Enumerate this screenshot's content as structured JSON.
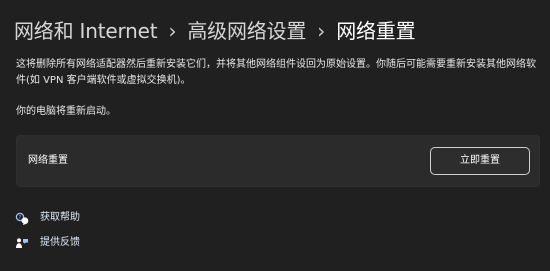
{
  "breadcrumb": {
    "items": [
      "网络和 Internet",
      "高级网络设置",
      "网络重置"
    ],
    "separator": "›"
  },
  "description": "这将删除所有网络适配器然后重新安装它们，并将其他网络组件设回为原始设置。你随后可能需要重新安装其他网络软件(如 VPN 客户端软件或虚拟交换机)。",
  "restart_note": "你的电脑将重新启动。",
  "reset_card": {
    "label": "网络重置",
    "button_label": "立即重置"
  },
  "links": {
    "help": {
      "label": "获取帮助",
      "icon": "help-chat-icon"
    },
    "feedback": {
      "label": "提供反馈",
      "icon": "feedback-icon"
    }
  },
  "colors": {
    "background": "#202020",
    "card": "#2b2b2b",
    "accent_link_icon": "#9fc4ff"
  }
}
